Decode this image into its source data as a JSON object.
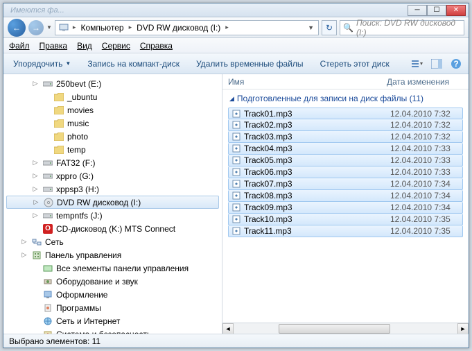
{
  "titlebar": {
    "ghost_text": "Имеются фа..."
  },
  "nav": {
    "arrow_back": "◄",
    "arrow_fwd": "►"
  },
  "breadcrumb": {
    "item1": "Компьютер",
    "item2": "DVD RW дисковод (I:)"
  },
  "search": {
    "placeholder": "Поиск: DVD RW дисковод (I:)"
  },
  "menu": {
    "file": "Файл",
    "edit": "Правка",
    "view": "Вид",
    "tools": "Сервис",
    "help": "Справка"
  },
  "toolbar": {
    "organize": "Упорядочить",
    "burn": "Запись на компакт-диск",
    "delete_temp": "Удалить временные файлы",
    "erase": "Стереть этот диск"
  },
  "tree": {
    "items": [
      {
        "indent": 2,
        "icon": "drive",
        "label": "250bevt (E:)"
      },
      {
        "indent": 3,
        "icon": "folder",
        "label": "_ubuntu"
      },
      {
        "indent": 3,
        "icon": "folder",
        "label": "movies"
      },
      {
        "indent": 3,
        "icon": "folder",
        "label": "music"
      },
      {
        "indent": 3,
        "icon": "folder",
        "label": "photo"
      },
      {
        "indent": 3,
        "icon": "folder",
        "label": "temp"
      },
      {
        "indent": 2,
        "icon": "drive",
        "label": "FAT32 (F:)"
      },
      {
        "indent": 2,
        "icon": "drive",
        "label": "xppro (G:)"
      },
      {
        "indent": 2,
        "icon": "drive",
        "label": "xppsp3 (H:)"
      },
      {
        "indent": 2,
        "icon": "cd",
        "label": "DVD RW дисковод (I:)",
        "selected": true
      },
      {
        "indent": 2,
        "icon": "drive",
        "label": "tempntfs (J:)"
      },
      {
        "indent": 2,
        "icon": "opera",
        "label": "CD-дисковод (K:) MTS Connect"
      },
      {
        "indent": 1,
        "icon": "net",
        "label": "Сеть"
      },
      {
        "indent": 1,
        "icon": "panel",
        "label": "Панель управления"
      },
      {
        "indent": 2,
        "icon": "panel-green",
        "label": "Все элементы панели управления"
      },
      {
        "indent": 2,
        "icon": "hw",
        "label": "Оборудование и звук"
      },
      {
        "indent": 2,
        "icon": "appear",
        "label": "Оформление"
      },
      {
        "indent": 2,
        "icon": "prog",
        "label": "Программы"
      },
      {
        "indent": 2,
        "icon": "netinet",
        "label": "Сеть и Интернет"
      },
      {
        "indent": 2,
        "icon": "security",
        "label": "Система и безопасность"
      }
    ]
  },
  "columns": {
    "name": "Имя",
    "date": "Дата изменения"
  },
  "group": {
    "title": "Подготовленные для записи на диск файлы (11)"
  },
  "files": [
    {
      "name": "Track01.mp3",
      "date": "12.04.2010 7:32"
    },
    {
      "name": "Track02.mp3",
      "date": "12.04.2010 7:32"
    },
    {
      "name": "Track03.mp3",
      "date": "12.04.2010 7:32"
    },
    {
      "name": "Track04.mp3",
      "date": "12.04.2010 7:33"
    },
    {
      "name": "Track05.mp3",
      "date": "12.04.2010 7:33"
    },
    {
      "name": "Track06.mp3",
      "date": "12.04.2010 7:33"
    },
    {
      "name": "Track07.mp3",
      "date": "12.04.2010 7:34"
    },
    {
      "name": "Track08.mp3",
      "date": "12.04.2010 7:34"
    },
    {
      "name": "Track09.mp3",
      "date": "12.04.2010 7:34"
    },
    {
      "name": "Track10.mp3",
      "date": "12.04.2010 7:35"
    },
    {
      "name": "Track11.mp3",
      "date": "12.04.2010 7:35"
    }
  ],
  "status": {
    "text": "Выбрано элементов: 11"
  }
}
